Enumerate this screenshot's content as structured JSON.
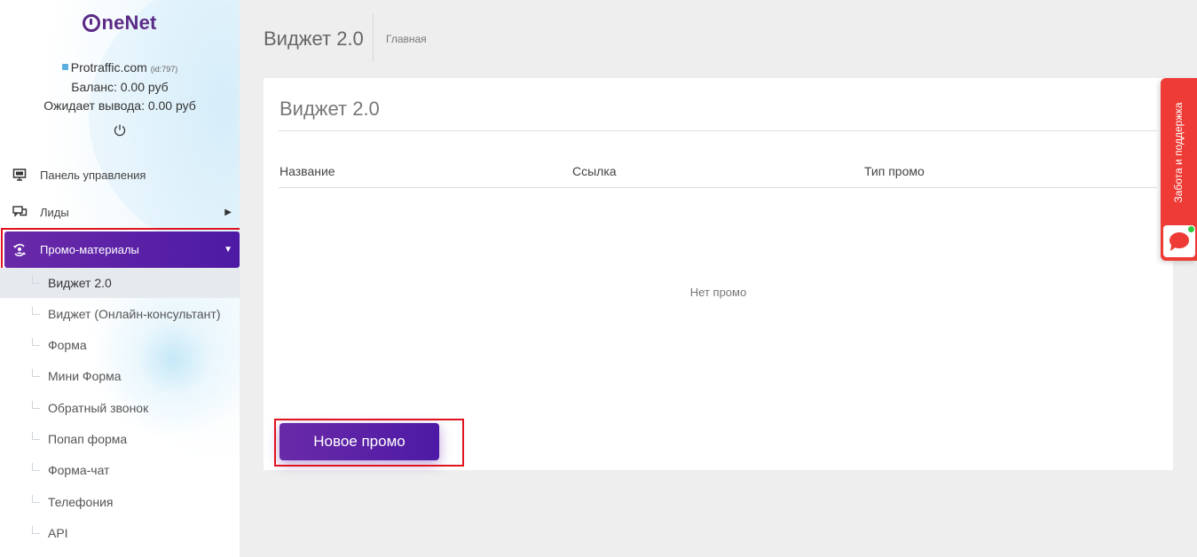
{
  "brand": {
    "logo_text": "neNet"
  },
  "account": {
    "name": "Protraffic.com",
    "id_label": "(id:797)",
    "balance": "Баланс: 0.00 руб",
    "pending": "Ожидает вывода: 0.00 руб"
  },
  "nav": {
    "dashboard": "Панель управления",
    "leads": "Лиды",
    "promo": "Промо-материалы"
  },
  "submenu": [
    "Виджет 2.0",
    "Виджет (Онлайн-консультант)",
    "Форма",
    "Мини Форма",
    "Обратный звонок",
    "Попап форма",
    "Форма-чат",
    "Телефония",
    "API"
  ],
  "header": {
    "title": "Виджет 2.0",
    "breadcrumb": "Главная"
  },
  "card": {
    "title": "Виджет 2.0",
    "columns": [
      "Название",
      "Ссылка",
      "Тип промо"
    ],
    "empty_text": "Нет промо",
    "new_button": "Новое промо"
  },
  "support": {
    "label": "Забота и поддержка"
  },
  "colors": {
    "accent": "#5b2a86",
    "active_gradient_start": "#6a2aa8",
    "active_gradient_end": "#4d1aa5",
    "support_red": "#ee3b35",
    "highlight_red": "#e0141e"
  }
}
